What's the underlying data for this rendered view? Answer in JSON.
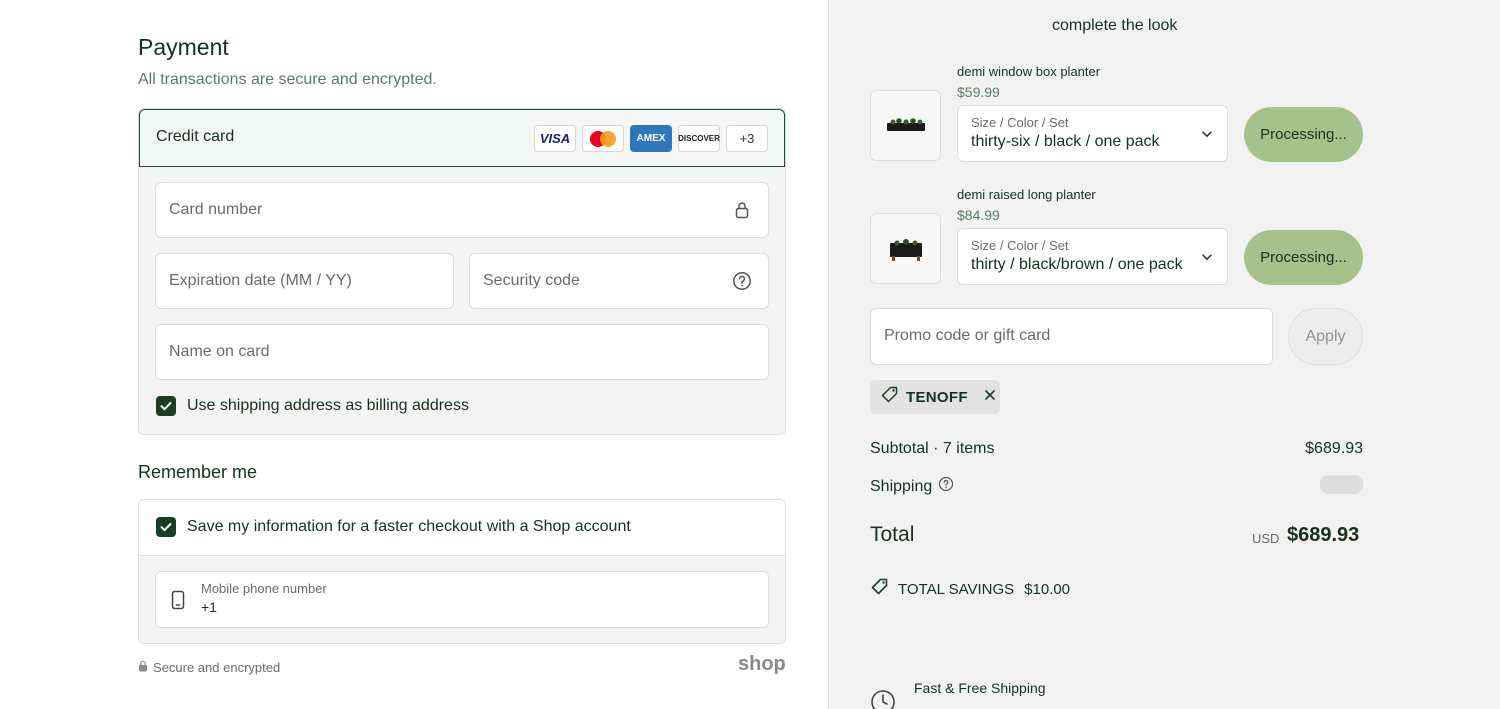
{
  "payment": {
    "title": "Payment",
    "subtitle": "All transactions are secure and encrypted.",
    "method_label": "Credit card",
    "card_logos": [
      "VISA",
      "AMEX",
      "DISCOVER"
    ],
    "more_cards": "+3",
    "card_number_placeholder": "Card number",
    "expiration_placeholder": "Expiration date (MM / YY)",
    "security_code_placeholder": "Security code",
    "name_placeholder": "Name on card",
    "billing_checkbox_label": "Use shipping address as billing address",
    "billing_checked": true
  },
  "remember": {
    "title": "Remember me",
    "save_label": "Save my information for a faster checkout with a Shop account",
    "save_checked": true,
    "phone_label": "Mobile phone number",
    "phone_value": "+1"
  },
  "footer": {
    "secure_text": "Secure and encrypted",
    "shop_logo": "shop"
  },
  "sidebar": {
    "look_title": "complete the look",
    "products": [
      {
        "name": "demi window box planter",
        "price": "$59.99",
        "select_label": "Size / Color / Set",
        "select_value": "thirty-six / black / one pack",
        "button": "Processing..."
      },
      {
        "name": "demi raised long planter",
        "price": "$84.99",
        "select_label": "Size / Color / Set",
        "select_value": "thirty / black/brown / one pack",
        "button": "Processing..."
      }
    ],
    "promo_placeholder": "Promo code or gift card",
    "apply_label": "Apply",
    "discount_code": "TENOFF",
    "subtotal_label": "Subtotal · 7 items",
    "subtotal_value": "$689.93",
    "shipping_label": "Shipping",
    "total_label": "Total",
    "currency": "USD",
    "total_value": "$689.93",
    "savings_label": "TOTAL SAVINGS",
    "savings_value": "$10.00",
    "fast_shipping": "Fast & Free Shipping"
  },
  "colors": {
    "accent_dark_green": "#1b3d26",
    "processing_green": "#a4c28a",
    "sidebar_bg": "#f2f2f2"
  }
}
